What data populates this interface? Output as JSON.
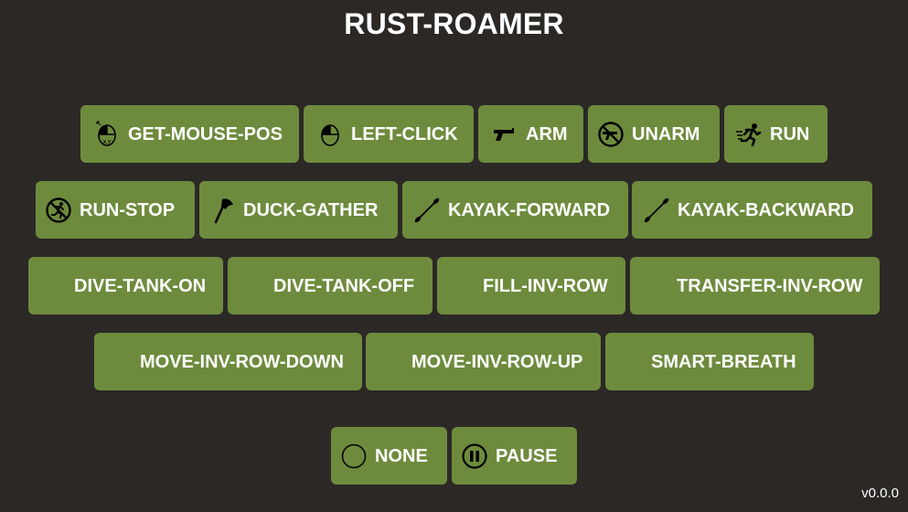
{
  "app": {
    "title": "RUST-ROAMER",
    "version": "v0.0.0"
  },
  "colors": {
    "background": "#2b2826",
    "button": "#6e8b3d",
    "text": "#ffffff"
  },
  "rows": [
    [
      {
        "label": "GET-MOUSE-POS",
        "icon": "mouse-xy-icon"
      },
      {
        "label": "LEFT-CLICK",
        "icon": "mouse-left-icon"
      },
      {
        "label": "ARM",
        "icon": "pistol-icon"
      },
      {
        "label": "UNARM",
        "icon": "no-pistol-icon"
      },
      {
        "label": "RUN",
        "icon": "running-man-icon"
      }
    ],
    [
      {
        "label": "RUN-STOP",
        "icon": "no-running-icon"
      },
      {
        "label": "DUCK-GATHER",
        "icon": "axe-icon"
      },
      {
        "label": "KAYAK-FORWARD",
        "icon": "paddle-icon"
      },
      {
        "label": "KAYAK-BACKWARD",
        "icon": "paddle-icon"
      }
    ],
    [
      {
        "label": "DIVE-TANK-ON",
        "icon": ""
      },
      {
        "label": "DIVE-TANK-OFF",
        "icon": ""
      },
      {
        "label": "FILL-INV-ROW",
        "icon": ""
      },
      {
        "label": "TRANSFER-INV-ROW",
        "icon": ""
      }
    ],
    [
      {
        "label": "MOVE-INV-ROW-DOWN",
        "icon": ""
      },
      {
        "label": "MOVE-INV-ROW-UP",
        "icon": ""
      },
      {
        "label": "SMART-BREATH",
        "icon": ""
      }
    ]
  ],
  "controls": [
    {
      "label": "NONE",
      "icon": "circle-icon"
    },
    {
      "label": "PAUSE",
      "icon": "pause-icon"
    }
  ]
}
